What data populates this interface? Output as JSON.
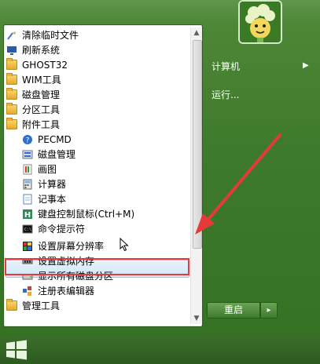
{
  "program_list": {
    "items": [
      {
        "label": "清除临时文件",
        "icon": "broom-icon",
        "level": 0
      },
      {
        "label": "刷新系统",
        "icon": "monitor-icon",
        "level": 0
      },
      {
        "label": "GHOST32",
        "icon": "folder-icon",
        "level": 0
      },
      {
        "label": "WIM工具",
        "icon": "folder-icon",
        "level": 0
      },
      {
        "label": "磁盘管理",
        "icon": "folder-icon",
        "level": 0
      },
      {
        "label": "分区工具",
        "icon": "folder-icon",
        "level": 0
      },
      {
        "label": "附件工具",
        "icon": "folder-icon",
        "level": 0
      },
      {
        "label": "PECMD",
        "icon": "question-icon",
        "level": 1
      },
      {
        "label": "磁盘管理",
        "icon": "disk-management-icon",
        "level": 1
      },
      {
        "label": "画图",
        "icon": "paint-icon",
        "level": 1
      },
      {
        "label": "计算器",
        "icon": "calculator-icon",
        "level": 1
      },
      {
        "label": "记事本",
        "icon": "notepad-icon",
        "level": 1
      },
      {
        "label": "键盘控制鼠标(Ctrl+M)",
        "icon": "keyboard-mouse-icon",
        "level": 1
      },
      {
        "label": "命令提示符",
        "icon": "cmd-icon",
        "level": 1
      },
      {
        "label": "设置屏幕分辨率",
        "icon": "display-resolution-icon",
        "level": 1,
        "highlighted": true
      },
      {
        "label": "设置虚拟内存",
        "icon": "memory-icon",
        "level": 1
      },
      {
        "label": "显示所有磁盘分区",
        "icon": "drive-icon",
        "level": 1
      },
      {
        "label": "注册表编辑器",
        "icon": "registry-icon",
        "level": 1
      },
      {
        "label": "管理工具",
        "icon": "folder-icon",
        "level": 0
      }
    ]
  },
  "right_column": {
    "computer_label": "计算机",
    "run_label": "运行..."
  },
  "shutdown": {
    "label": "重启",
    "arrow": "▸"
  },
  "colors": {
    "frame_green": "#3e7a2b",
    "highlight_red": "#e53a3a",
    "selection_blue": "#d1e6fa"
  }
}
